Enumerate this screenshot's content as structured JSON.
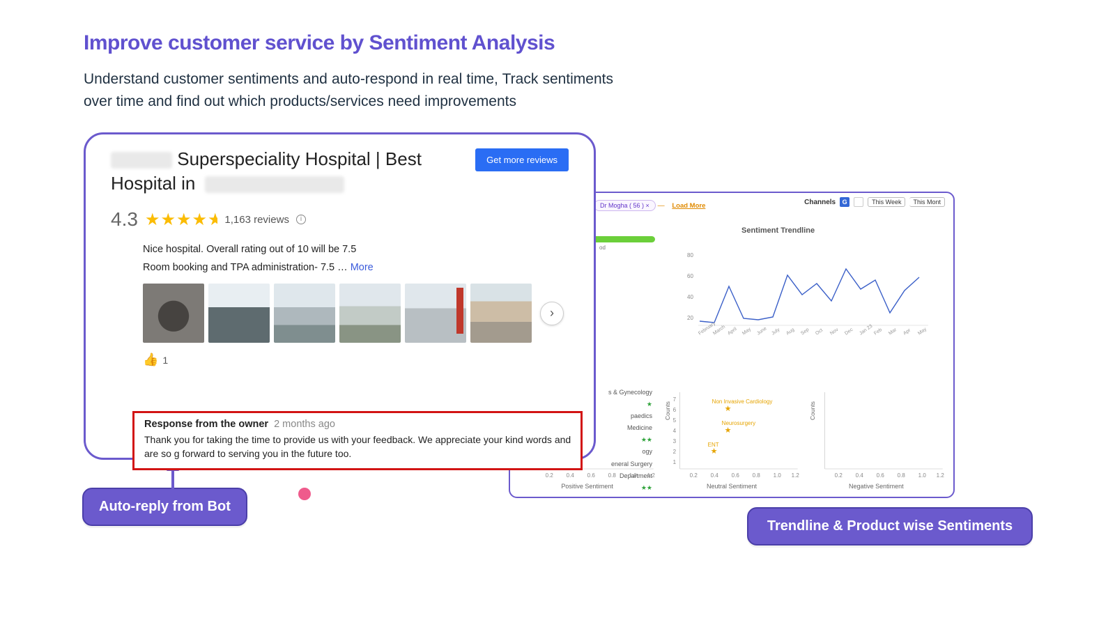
{
  "title": "Improve customer service by Sentiment Analysis",
  "subtitle": "Understand customer sentiments and auto-respond in real time, Track sentiments over time and find out which products/services need improvements",
  "review": {
    "biz_name_visible_mid": "Superspeciality Hospital | Best",
    "biz_name_line2_prefix": "Hospital in",
    "get_more_reviews": "Get more reviews",
    "rating": "4.3",
    "reviews_count": "1,163 reviews",
    "text_line1": "Nice hospital. Overall rating out of 10 will be 7.5",
    "text_line2_prefix": "Room booking and TPA administration- 7.5 … ",
    "more_label": "More",
    "like_count": "1",
    "owner_from": "Response from the owner",
    "owner_ago": "2 months ago",
    "owner_text": "Thank you for taking the time to provide us with your feedback. We appreciate your kind words and are so g forward to serving you in the future too."
  },
  "callouts": {
    "auto_reply": "Auto-reply from Bot",
    "trendline": "Trendline & Product wise Sentiments"
  },
  "dashboard": {
    "channels_label": "Channels",
    "channel_badge": "G",
    "this_week": "This Week",
    "this_month": "This Mont",
    "chip_text": "Dr Mogha ( 56 )  ×",
    "load_more": "Load More",
    "green_bar_label": "od",
    "trend_title": "Sentiment Trendline",
    "side_categories": [
      "s & Gynecology",
      "paedics",
      "Medicine",
      "ogy",
      "eneral Surgery",
      "Department"
    ],
    "mini_titles": {
      "positive": "Positive Sentiment",
      "neutral": "Neutral Sentiment",
      "negative": "Negative Sentiment"
    },
    "neutral_labels": [
      "Non Invasive Cardiology",
      "Neurosurgery",
      "ENT"
    ],
    "counts_label": "Counts",
    "x_ticks": [
      "0.2",
      "0.4",
      "0.6",
      "0.8",
      "1.0",
      "1.2"
    ]
  },
  "chart_data": {
    "type": "line",
    "title": "Sentiment Trendline",
    "ylabel": "",
    "ylim": [
      0,
      80
    ],
    "y_ticks": [
      20,
      40,
      60,
      80
    ],
    "categories": [
      "February 2022",
      "March 2022",
      "April 2022",
      "May 2022",
      "June 2022",
      "July 2022",
      "Aug 2022",
      "Sep 2022",
      "Oct 2022",
      "Nov 2022",
      "Dec 2022",
      "Jan 2023",
      "Feb 2023",
      "Mar 2023",
      "Apr 2023",
      "May 2023"
    ],
    "values": [
      5,
      3,
      45,
      8,
      6,
      10,
      58,
      35,
      48,
      28,
      65,
      42,
      52,
      14,
      40,
      55
    ]
  }
}
